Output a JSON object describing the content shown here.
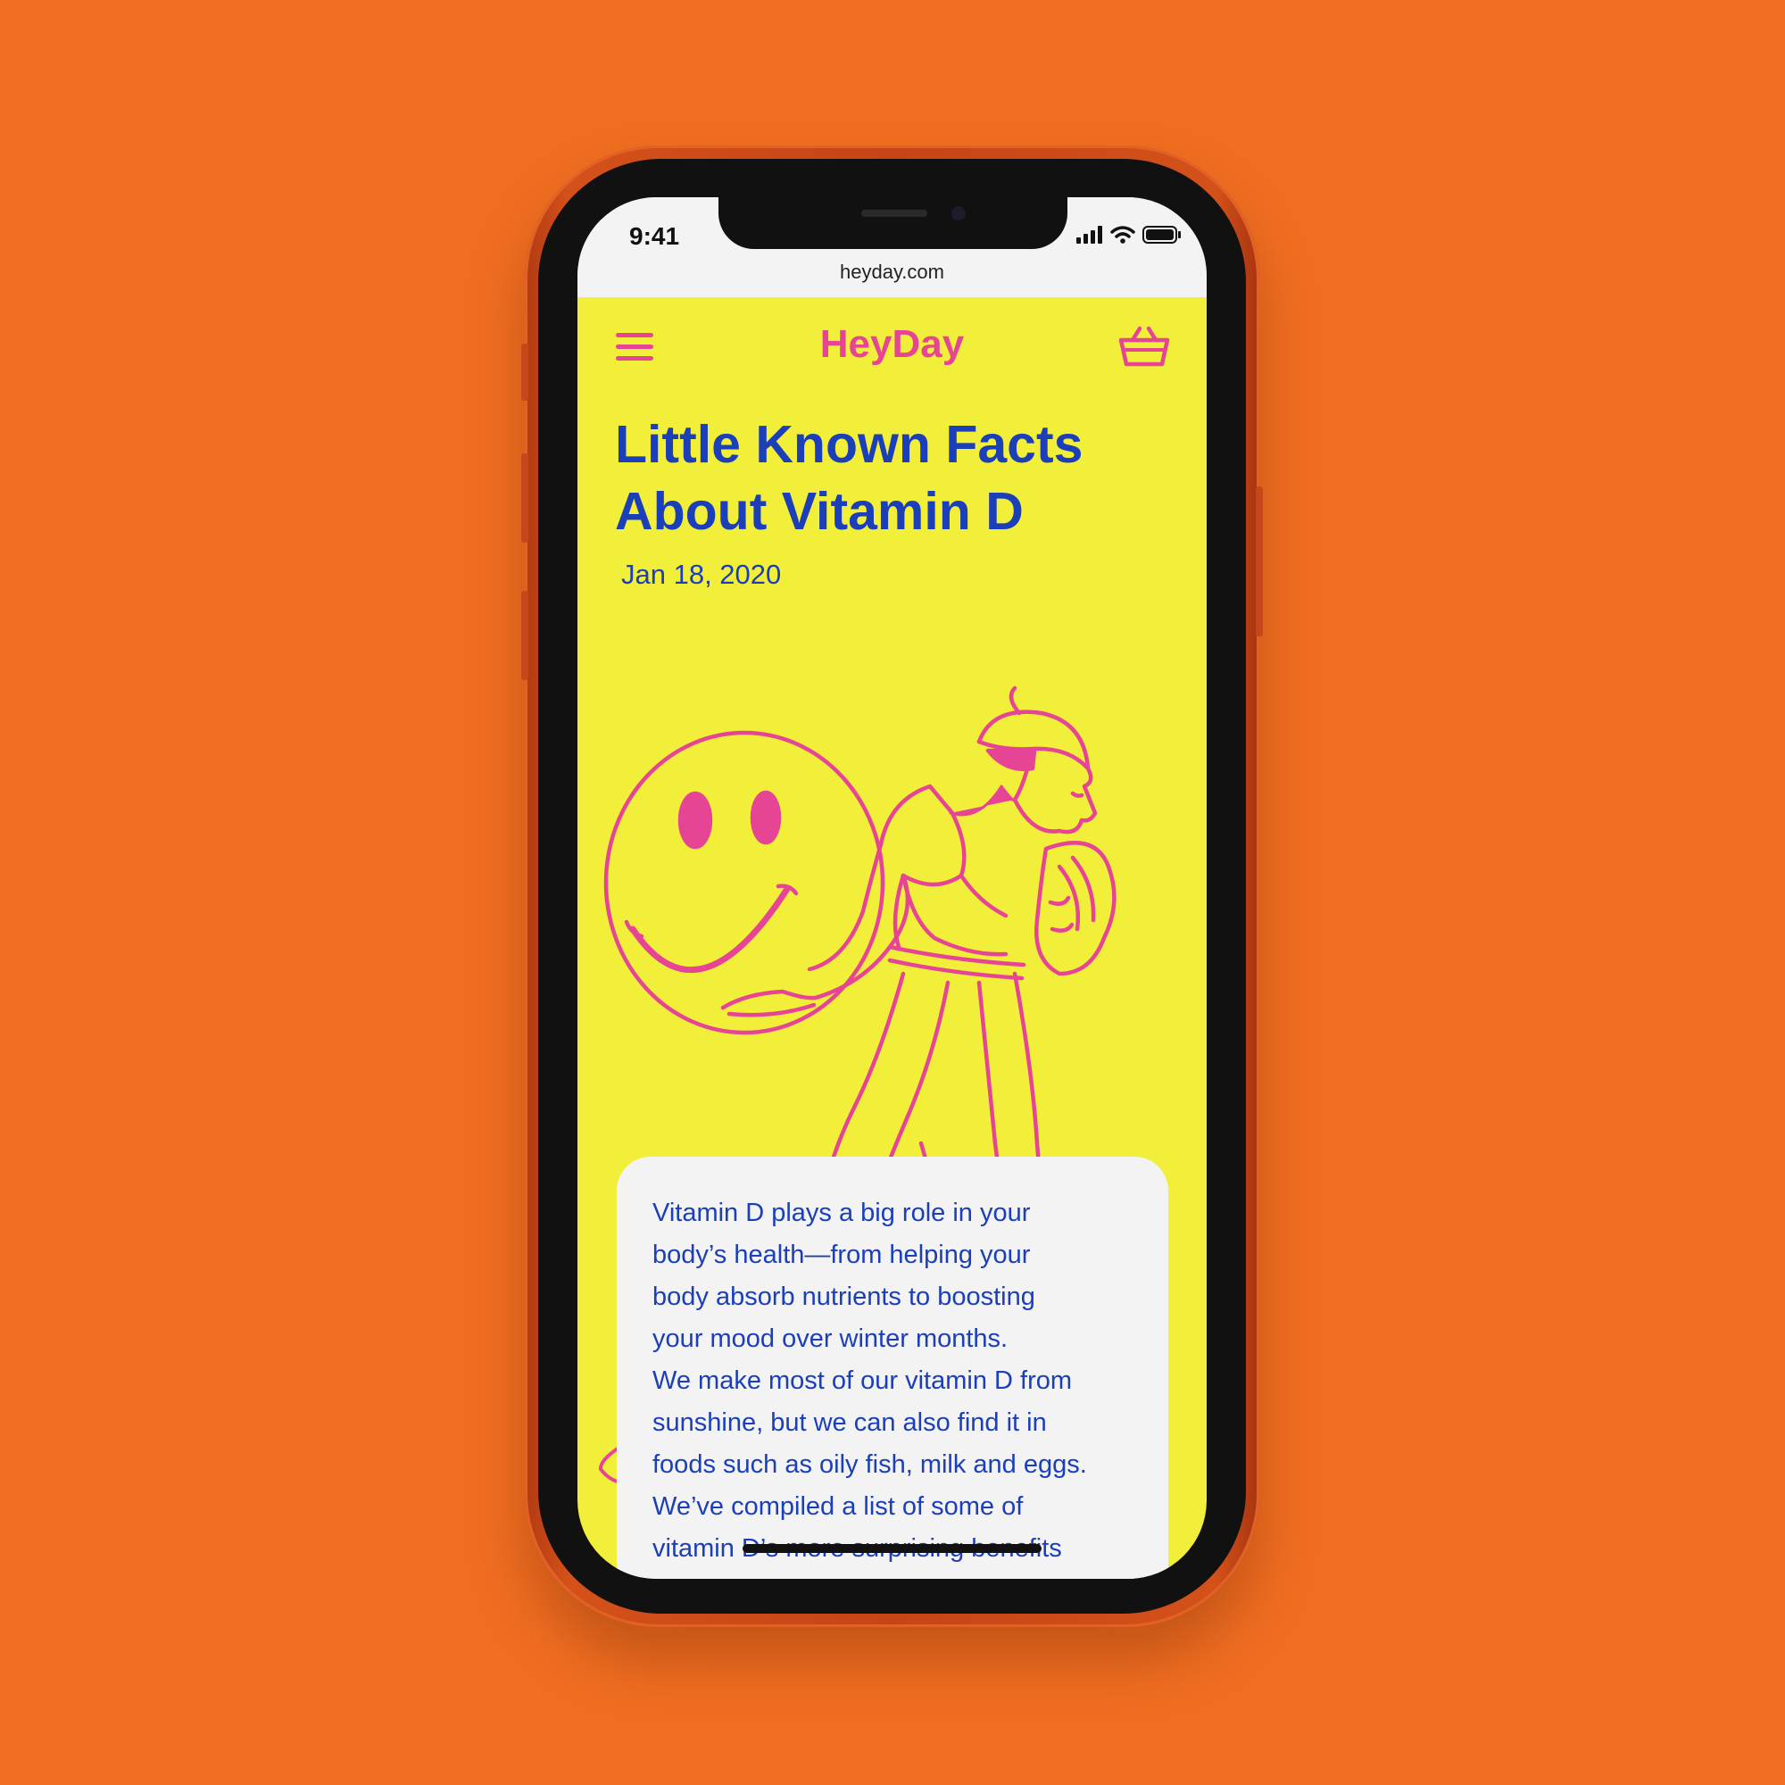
{
  "status_bar": {
    "time": "9:41",
    "icons": [
      "signal-icon",
      "wifi-icon",
      "battery-icon"
    ]
  },
  "browser": {
    "url": "heyday.com"
  },
  "nav": {
    "brand": "HeyDay",
    "menu_icon": "hamburger-menu-icon",
    "cart_icon": "basket-icon"
  },
  "article": {
    "title": "Little Known Facts About Vitamin D",
    "date": "Jan 18, 2020",
    "body_lines": [
      "Vitamin D plays a big role in your",
      "body’s health—from helping your",
      "body absorb nutrients to boosting",
      "your mood over winter months.",
      "We make most of our vitamin D from",
      "sunshine, but we can also find it in",
      "foods such as oily fish, milk and eggs.",
      "We’ve compiled a list of some of",
      "vitamin D’s more surprising benefits"
    ]
  },
  "colors": {
    "background": "#F06E21",
    "screen": "#F2EF3A",
    "accent_pink": "#E64596",
    "text_blue": "#1B3FB8",
    "card": "#F3F3F4"
  }
}
